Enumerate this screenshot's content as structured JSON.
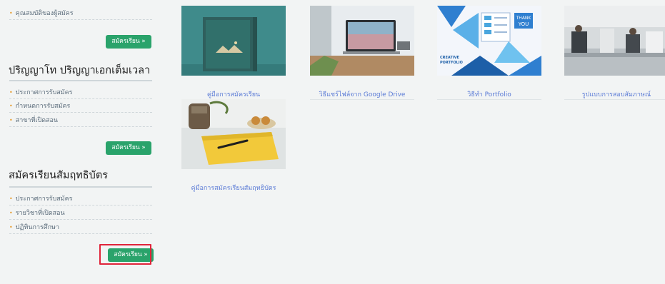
{
  "sidebar": {
    "sections": [
      {
        "items": [
          "คุณสมบัติของผู้สมัคร"
        ],
        "button": "สมัครเรียน »"
      },
      {
        "title": "ปริญญาโท ปริญญาเอกเต็มเวลา",
        "items": [
          "ประกาศการรับสมัคร",
          "กำหนดการรับสมัคร",
          "สาขาที่เปิดสอน"
        ],
        "button": "สมัครเรียน »"
      },
      {
        "title": "สมัครเรียนสัมฤทธิบัตร",
        "items": [
          "ประกาศการรับสมัคร",
          "รายวิชาที่เปิดสอน",
          "ปฏิทินการศึกษา"
        ],
        "button": "สมัครเรียน »"
      }
    ]
  },
  "cards": [
    {
      "caption": "คู่มือการสมัครเรียน"
    },
    {
      "caption": "วิธีแชร์ไฟล์จาก Google Drive"
    },
    {
      "caption": "วิธีทำ Portfolio",
      "thumb_text": {
        "thank": "THANK",
        "you": "YOU",
        "creative": "CREATIVE",
        "portfolio": "PORTFOLIO"
      }
    },
    {
      "caption": "รูปแบบการสอบสัมภาษณ์"
    },
    {
      "caption": "คู่มือการสมัครเรียนสัมฤทธิบัตร"
    }
  ],
  "colors": {
    "accent_green": "#2aa36b",
    "highlight_red": "#e0243a",
    "link_blue": "#5b7bd6",
    "bullet_orange": "#e59a2c"
  }
}
